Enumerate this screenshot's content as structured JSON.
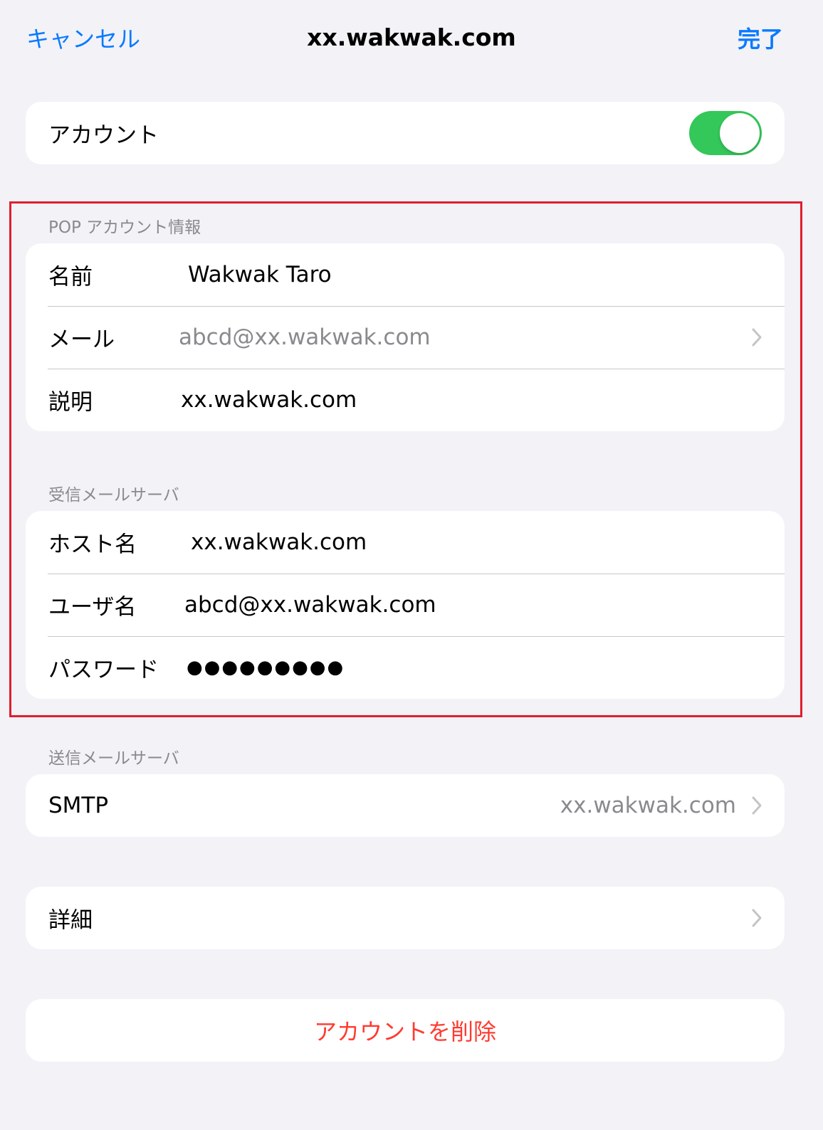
{
  "nav": {
    "cancel_label": "キャンセル",
    "title": "xx.wakwak.com",
    "done_label": "完了"
  },
  "account_row": {
    "label": "アカウント",
    "toggle_on": true
  },
  "pop_section": {
    "header": "POP アカウント情報",
    "rows": [
      {
        "label": "名前",
        "value": "Wakwak Taro"
      },
      {
        "label": "メール",
        "value": "abcd@xx.wakwak.com"
      },
      {
        "label": "説明",
        "value": "xx.wakwak.com"
      }
    ]
  },
  "incoming_section": {
    "header": "受信メールサーバ",
    "rows": [
      {
        "label": "ホスト名",
        "value": "xx.wakwak.com"
      },
      {
        "label": "ユーザ名",
        "value": "abcd@xx.wakwak.com"
      },
      {
        "label": "パスワード",
        "value": "●●●●●●●●●"
      }
    ]
  },
  "outgoing_section": {
    "header": "送信メールサーバ",
    "smtp_label": "SMTP",
    "smtp_value": "xx.wakwak.com"
  },
  "details_row": {
    "label": "詳細"
  },
  "delete_button": {
    "label": "アカウントを削除"
  },
  "colors": {
    "accent": "#0a7aff",
    "toggle_on": "#34c759",
    "destructive": "#ff3b30",
    "highlight_border": "#e01e2e",
    "background": "#f2f2f7"
  }
}
